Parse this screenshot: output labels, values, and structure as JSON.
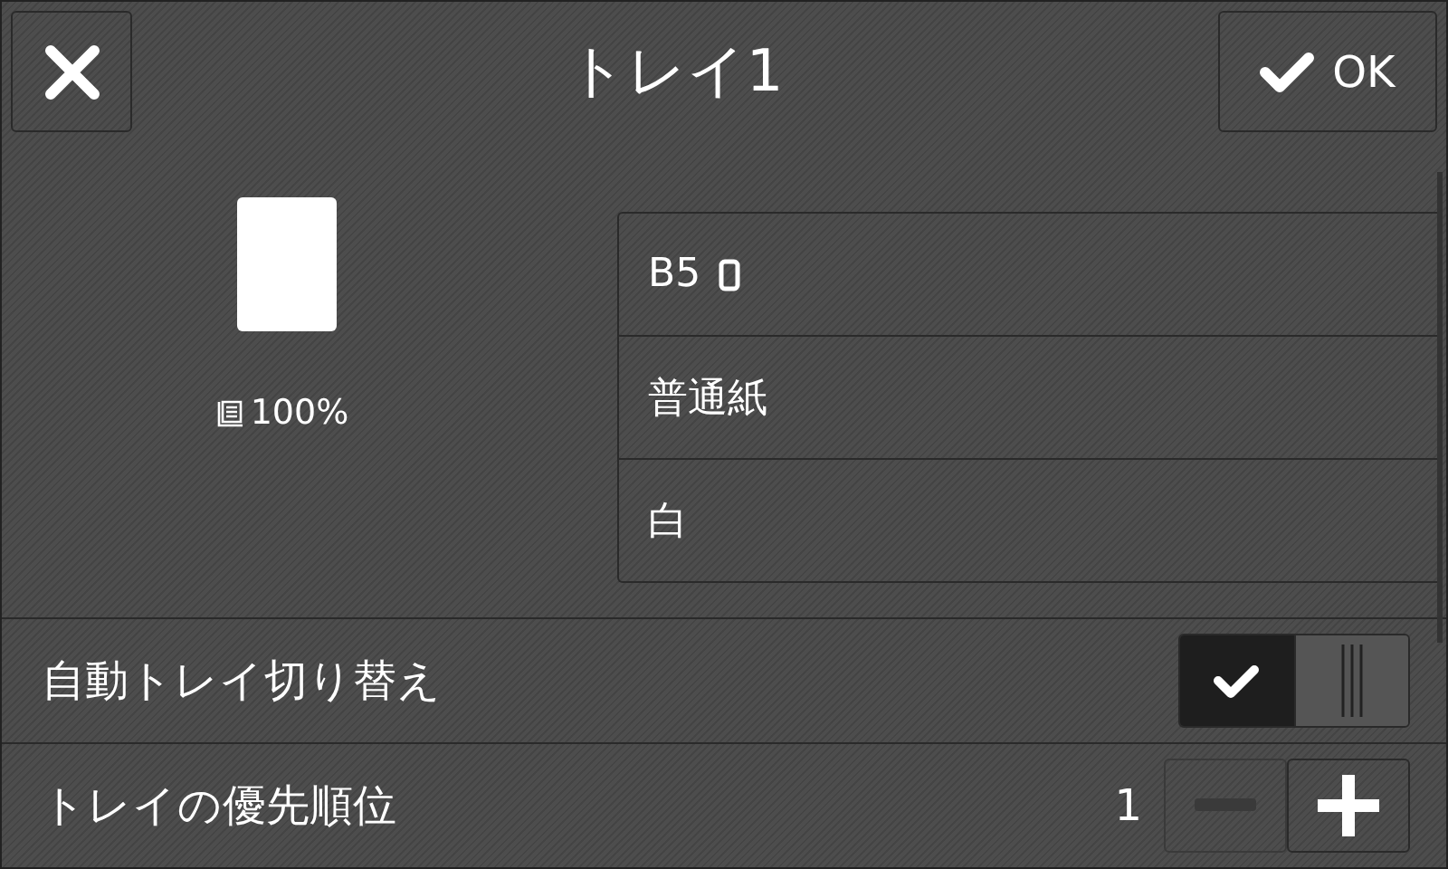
{
  "title": "トレイ1",
  "ok_button": {
    "label": "OK"
  },
  "paper": {
    "remaining": "100%"
  },
  "settings": [
    {
      "kind": "size",
      "value": "B5"
    },
    {
      "kind": "text",
      "value": "普通紙"
    },
    {
      "kind": "text",
      "value": "白"
    }
  ],
  "auto_switch": {
    "label": "自動トレイ切り替え",
    "on": true
  },
  "priority": {
    "label": "トレイの優先順位",
    "value": "1",
    "decrease_disabled": true
  }
}
